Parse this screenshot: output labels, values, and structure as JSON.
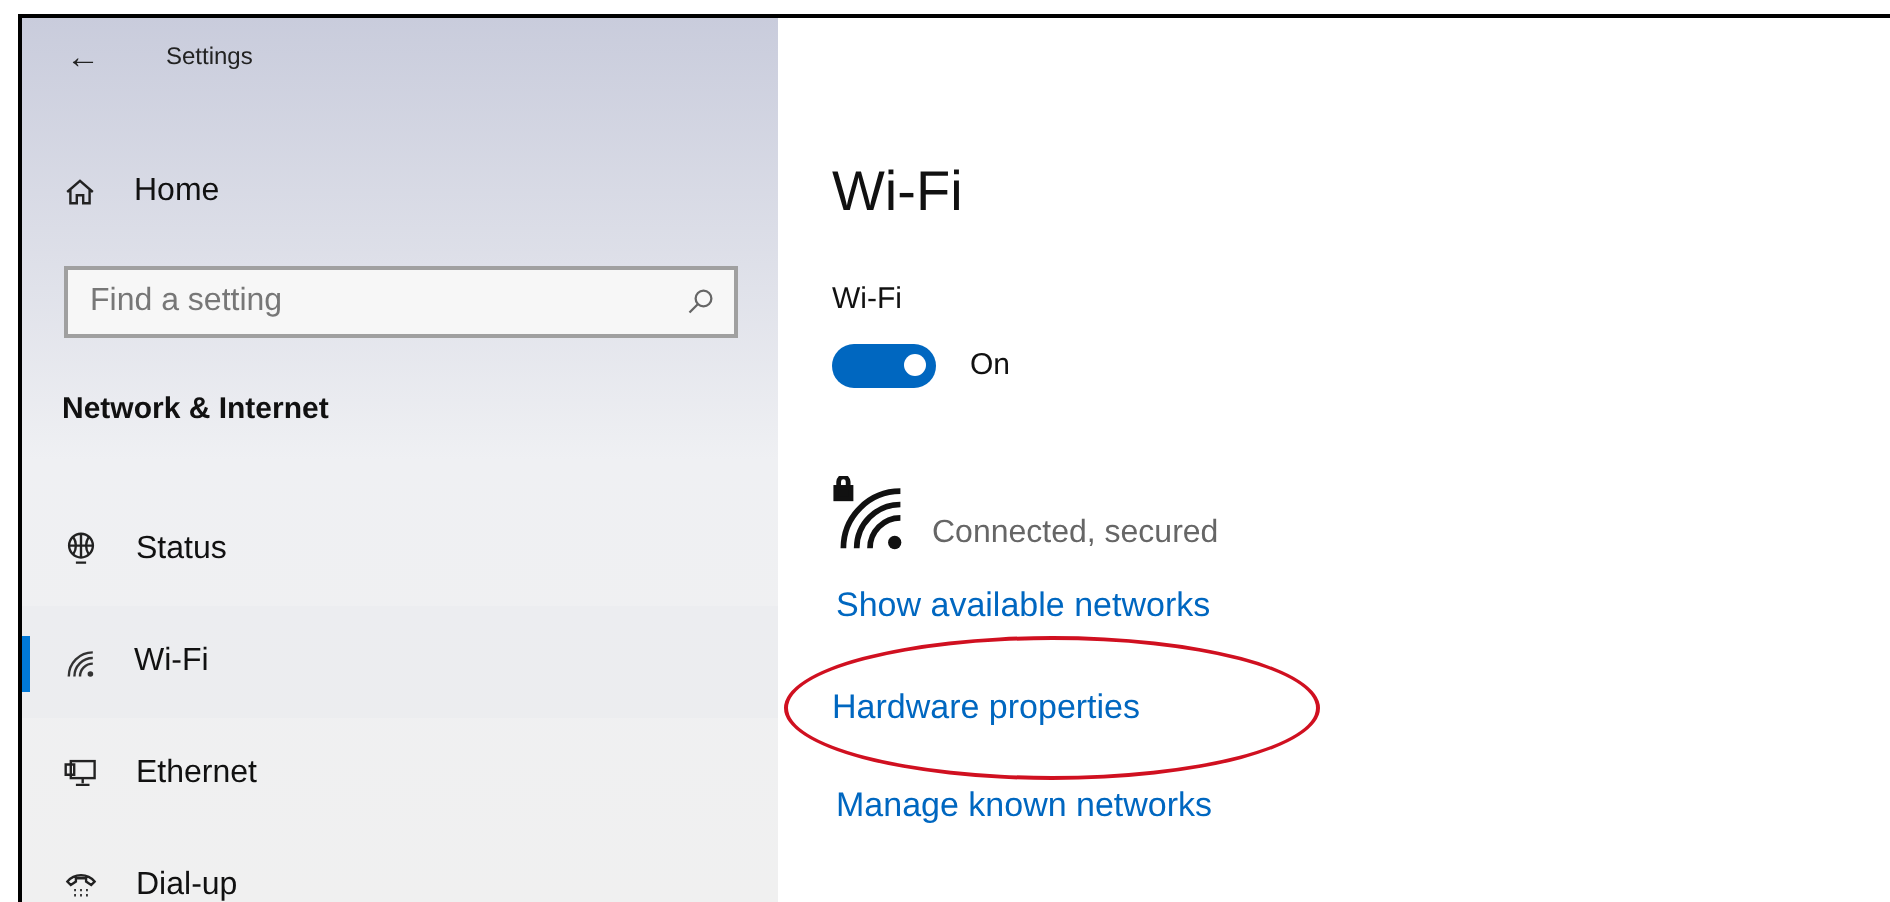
{
  "window": {
    "title": "Settings",
    "back": "←"
  },
  "sidebar": {
    "home": "Home",
    "search": {
      "placeholder": "Find a setting"
    },
    "section": "Network & Internet",
    "items": [
      {
        "label": "Status",
        "kind": "status",
        "selected": false
      },
      {
        "label": "Wi-Fi",
        "kind": "wifi",
        "selected": true
      },
      {
        "label": "Ethernet",
        "kind": "ethernet",
        "selected": false
      },
      {
        "label": "Dial-up",
        "kind": "dialup",
        "selected": false
      }
    ]
  },
  "main": {
    "title": "Wi-Fi",
    "toggle": {
      "label": "Wi-Fi",
      "on": true,
      "state_text": "On"
    },
    "connection": {
      "status": "Connected, secured",
      "secured": true
    },
    "links": [
      {
        "label": "Show available networks",
        "highlighted": false
      },
      {
        "label": "Hardware properties",
        "highlighted": true
      },
      {
        "label": "Manage known networks",
        "highlighted": false
      }
    ]
  }
}
